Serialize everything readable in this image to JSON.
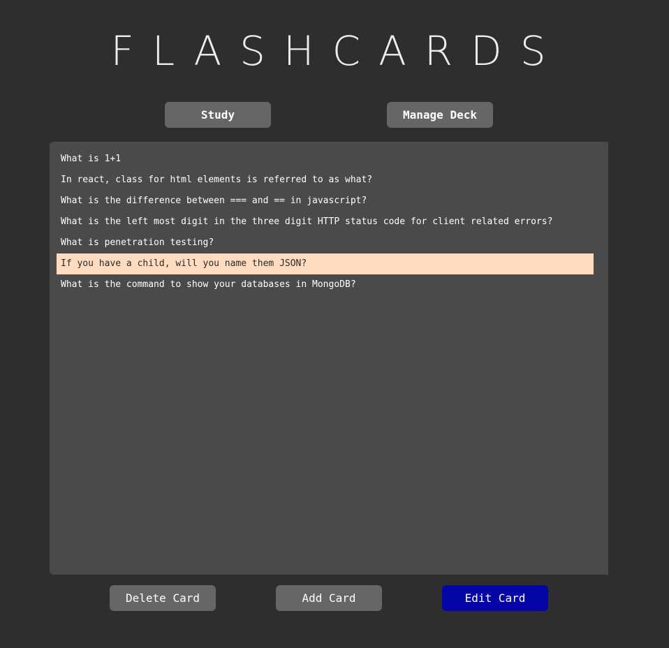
{
  "app": {
    "title": "FLASHCARDS"
  },
  "nav": {
    "study_label": "Study",
    "manage_label": "Manage Deck"
  },
  "cards": [
    {
      "question": "What is 1+1",
      "selected": false
    },
    {
      "question": "In react, class for html elements is referred to as what?",
      "selected": false
    },
    {
      "question": "What is the difference between === and == in javascript?",
      "selected": false
    },
    {
      "question": "What is the left most digit in the three digit HTTP status code for client related errors?",
      "selected": false
    },
    {
      "question": "What is penetration testing?",
      "selected": false
    },
    {
      "question": "If you have a child, will you name them JSON?",
      "selected": true
    },
    {
      "question": "What is the command to show your databases in MongoDB?",
      "selected": false
    }
  ],
  "actions": {
    "delete_label": "Delete Card",
    "add_label": "Add Card",
    "edit_label": "Edit Card"
  },
  "colors": {
    "background": "#2e2e2e",
    "panel": "#4a4a4a",
    "button": "#666666",
    "primary_button": "#0505a5",
    "selected_row": "#ffdbbf"
  }
}
